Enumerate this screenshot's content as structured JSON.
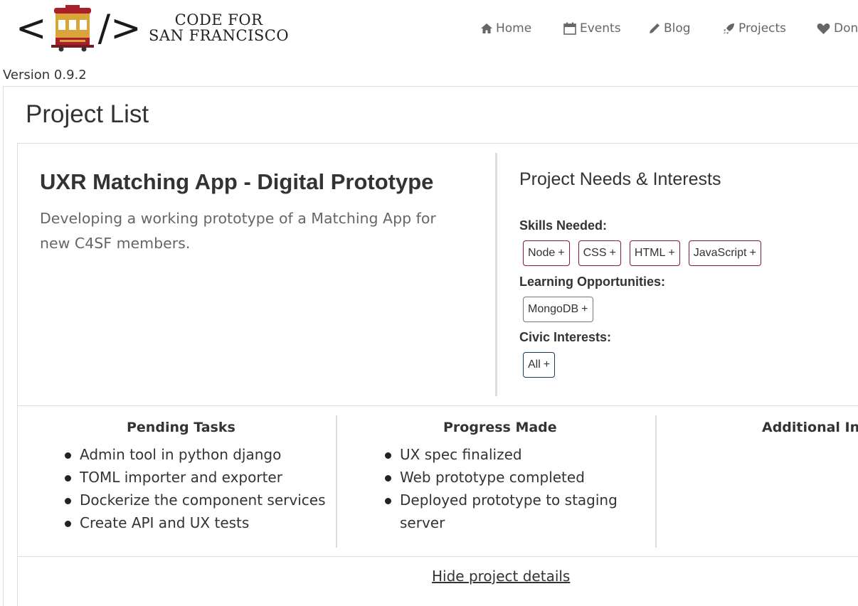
{
  "brand": {
    "line1": "CODE FOR",
    "line2": "SAN FRANCISCO",
    "colors": {
      "tram_red": "#a81f2a",
      "tram_gold": "#d9a43a"
    }
  },
  "nav": {
    "items": [
      {
        "label": "Home",
        "icon": "home-icon"
      },
      {
        "label": "Events",
        "icon": "calendar-icon"
      },
      {
        "label": "Blog",
        "icon": "pencil-icon"
      },
      {
        "label": "Projects",
        "icon": "rocket-icon"
      },
      {
        "label": "Don",
        "icon": "heart-icon"
      }
    ]
  },
  "version": "Version 0.9.2",
  "page": {
    "title": "Project List"
  },
  "project": {
    "name": "UXR Matching App - Digital Prototype",
    "description": "Developing a working prototype of a Matching App for new C4SF members.",
    "needs": {
      "title": "Project Needs & Interests",
      "skills_label": "Skills Needed:",
      "skills": [
        "Node",
        "CSS",
        "HTML",
        "JavaScript"
      ],
      "learning_label": "Learning Opportunities:",
      "learning": [
        "MongoDB"
      ],
      "civic_label": "Civic Interests:",
      "civic": [
        "All"
      ],
      "tag_suffix": "+"
    },
    "pending": {
      "title": "Pending Tasks",
      "items": [
        "Admin tool in python django",
        "TOML importer and exporter",
        "Dockerize the component services",
        "Create API and UX tests"
      ]
    },
    "progress": {
      "title": "Progress Made",
      "items": [
        "UX spec finalized",
        "Web prototype completed",
        "Deployed prototype to staging server"
      ]
    },
    "additional": {
      "title": "Additional Inf"
    },
    "hide_details": "Hide project details"
  }
}
